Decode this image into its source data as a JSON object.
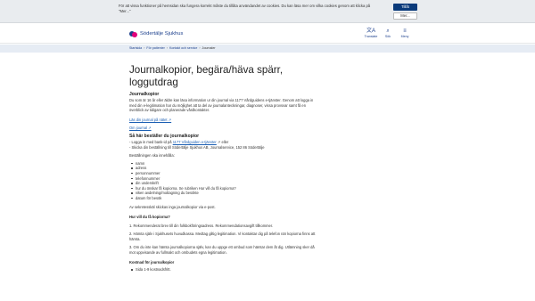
{
  "cookie": {
    "text": "För att vissa funktioner på hemsidan ska fungera korrekt måste du tillåta användandet av cookies. Du kan läsa mer om vilka cookies genom att klicka på \"Mer...\"",
    "ok_label": "Tillåt",
    "more_label": "Mer..."
  },
  "header": {
    "logo_text": "Södertälje Sjukhus",
    "tools": [
      {
        "label": "Translate",
        "icon": "translate-icon",
        "glyph": "文A"
      },
      {
        "label": "Sök",
        "icon": "search-icon",
        "glyph": "⌕"
      },
      {
        "label": "Meny",
        "icon": "menu-icon",
        "glyph": "≡"
      }
    ]
  },
  "breadcrumb": [
    "Startsida",
    "För patienter",
    "Kontakt och service",
    "Journaler"
  ],
  "main": {
    "title": "Journalkopior, begära/häva spärr, loggutdrag",
    "section1_heading": "Journalkopior",
    "section1_text": "Du som är 16 år eller äldre kan läsa information ur din journal via 1177 Vårdguidens e-tjänster. Genom att logga in med din e-legitimation har du möjlighet att ta del av journalanteckningar, diagnoser, vissa provsvar samt få en överblick av tidigare och planerade vårdkontakter.",
    "link1": "Läs din journal på nätet ↗",
    "link2": "Om journal ↗",
    "section2_heading": "Så här beställer du journalkopior",
    "order_line1_pre": "- Logga in med bank-id på ",
    "order_line1_link": "1177 Vårdguiden e-tjänster",
    "order_line1_post": " ↗ eller",
    "order_line2": "- Skicka din beställning till Södertälje Sjukhus AB, Journalservice, 152 86 Södertälje",
    "list_intro": "Beställningen ska innehålla:",
    "list_items": [
      "namn",
      "adress",
      "personnummer",
      "telefonnummer",
      "din underskrift",
      "hur du önskar få kopiorna. Se rubriken Hur vill du få kopiorna?",
      "viken avdelning/mottagning du besökte",
      "datum för besök"
    ],
    "secrecy_note": "Av sekretesskäl skickas inga journalkopior via e-post.",
    "how_heading": "Hur vill du få kopiorna?",
    "how_1": "1. Rekommenderat brev till din folkbokföringsadress. Rekommendationsavgift tillkommer.",
    "how_2": "2. Hämta själv i Sjukhusets huvudkassa. Medtag giltig legitimation. Vi kontaktar dig på telefon när kopiorna finns att hämta.",
    "how_3": "3. Om du inte kan hämta journalkopiorna själv, kan du uppge ett ombud som hämtar dem åt dig. Utlämning sker då mot uppvisande av fullmakt och ombudets egna legitimation.",
    "cost_heading": "Kostnad för journalkopior",
    "cost_1": "Sida 1-9 kostnadsfritt."
  },
  "colors": {
    "brand": "#1b3f8c",
    "accent": "#e2007a",
    "link": "#1b5fb3"
  }
}
